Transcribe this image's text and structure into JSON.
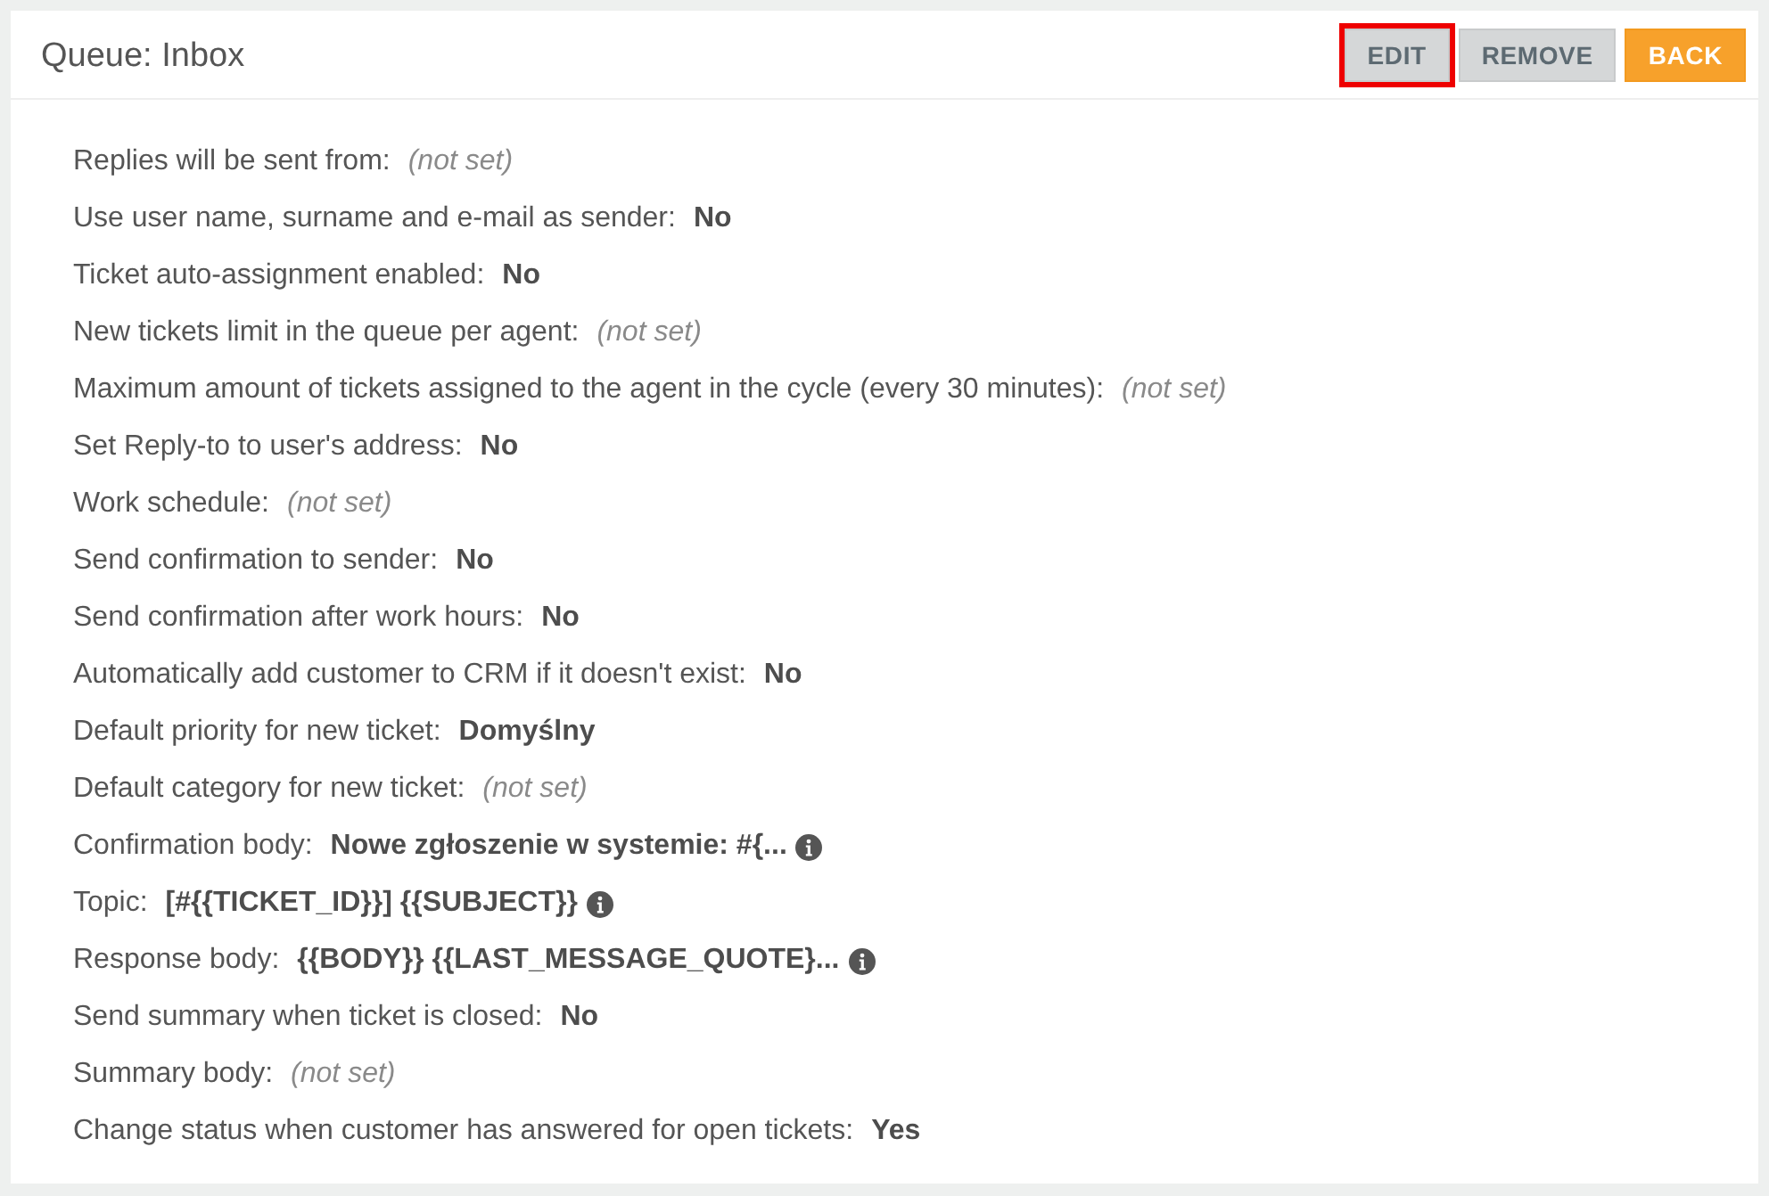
{
  "header": {
    "title": "Queue: Inbox",
    "buttons": [
      {
        "label": "EDIT",
        "kind": "secondary",
        "highlighted": true
      },
      {
        "label": "REMOVE",
        "kind": "secondary",
        "highlighted": false
      },
      {
        "label": "BACK",
        "kind": "primary",
        "highlighted": false
      }
    ]
  },
  "settings": [
    {
      "label": "Replies will be sent from:",
      "value": "(not set)",
      "kind": "unset",
      "info": false
    },
    {
      "label": "Use user name, surname and e-mail as sender:",
      "value": "No",
      "kind": "set",
      "info": false
    },
    {
      "label": "Ticket auto-assignment enabled:",
      "value": "No",
      "kind": "set",
      "info": false
    },
    {
      "label": "New tickets limit in the queue per agent:",
      "value": "(not set)",
      "kind": "unset",
      "info": false
    },
    {
      "label": "Maximum amount of tickets assigned to the agent in the cycle (every 30 minutes):",
      "value": "(not set)",
      "kind": "unset",
      "info": false
    },
    {
      "label": "Set Reply-to to user's address:",
      "value": "No",
      "kind": "set",
      "info": false
    },
    {
      "label": "Work schedule:",
      "value": "(not set)",
      "kind": "unset",
      "info": false
    },
    {
      "label": "Send confirmation to sender:",
      "value": "No",
      "kind": "set",
      "info": false
    },
    {
      "label": "Send confirmation after work hours:",
      "value": "No",
      "kind": "set",
      "info": false
    },
    {
      "label": "Automatically add customer to CRM if it doesn't exist:",
      "value": "No",
      "kind": "set",
      "info": false
    },
    {
      "label": "Default priority for new ticket:",
      "value": "Domyślny",
      "kind": "set",
      "info": false
    },
    {
      "label": "Default category for new ticket:",
      "value": "(not set)",
      "kind": "unset",
      "info": false
    },
    {
      "label": "Confirmation body:",
      "value": "Nowe zgłoszenie w systemie: #{...",
      "kind": "set",
      "info": true
    },
    {
      "label": "Topic:",
      "value": "[#{{TICKET_ID}}] {{SUBJECT}}",
      "kind": "set",
      "info": true
    },
    {
      "label": "Response body:",
      "value": "{{BODY}} {{LAST_MESSAGE_QUOTE}...",
      "kind": "set",
      "info": true
    },
    {
      "label": "Send summary when ticket is closed:",
      "value": "No",
      "kind": "set",
      "info": false
    },
    {
      "label": "Summary body:",
      "value": "(not set)",
      "kind": "unset",
      "info": false
    },
    {
      "label": "Change status when customer has answered for open tickets:",
      "value": "Yes",
      "kind": "set",
      "info": false
    }
  ]
}
